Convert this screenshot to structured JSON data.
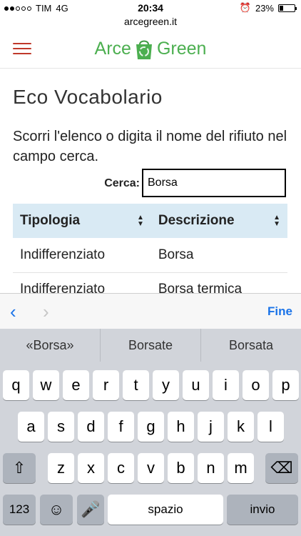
{
  "status": {
    "carrier": "TIM",
    "network": "4G",
    "time": "20:34",
    "battery": "23%",
    "battery_level": 0.23,
    "alarm_icon": "alarm-clock-icon"
  },
  "url": "arcegreen.it",
  "header": {
    "logo_left": "Arce",
    "logo_right": "Green",
    "brand_color": "#4caf50",
    "menu_icon": "hamburger-menu-icon"
  },
  "page": {
    "title": "Eco Vocabolario",
    "intro": "Scorri l'elenco o digita il nome del rifiuto nel campo cerca.",
    "search_label": "Cerca:",
    "search_value": "Borsa"
  },
  "table": {
    "headers": [
      "Tipologia",
      "Descrizione"
    ],
    "rows": [
      [
        "Indifferenziato",
        "Borsa"
      ],
      [
        "Indifferenziato",
        "Borsa termica"
      ]
    ]
  },
  "accessory": {
    "done_label": "Fine"
  },
  "keyboard": {
    "suggestions": [
      "«Borsa»",
      "Borsate",
      "Borsata"
    ],
    "row1": [
      "q",
      "w",
      "e",
      "r",
      "t",
      "y",
      "u",
      "i",
      "o",
      "p"
    ],
    "row2": [
      "a",
      "s",
      "d",
      "f",
      "g",
      "h",
      "j",
      "k",
      "l"
    ],
    "row3": [
      "z",
      "x",
      "c",
      "v",
      "b",
      "n",
      "m"
    ],
    "numbers_label": "123",
    "space_label": "spazio",
    "return_label": "invio"
  }
}
